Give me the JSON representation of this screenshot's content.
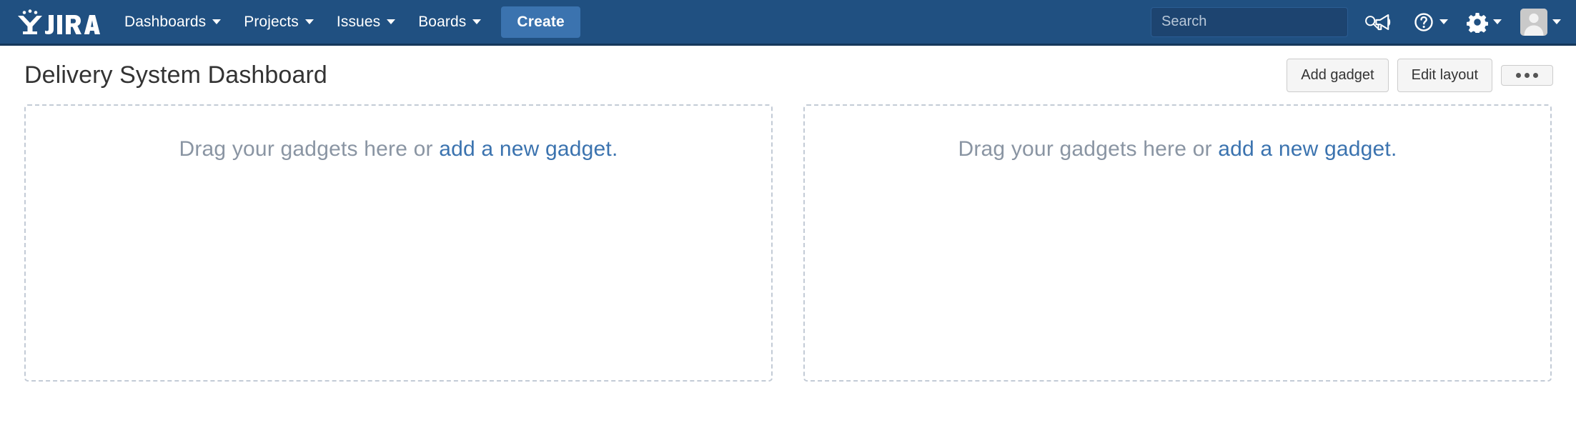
{
  "navbar": {
    "logo_label": "JIRA",
    "items": [
      {
        "label": "Dashboards",
        "has_caret": true
      },
      {
        "label": "Projects",
        "has_caret": true
      },
      {
        "label": "Issues",
        "has_caret": true
      },
      {
        "label": "Boards",
        "has_caret": true
      }
    ],
    "create_label": "Create",
    "search": {
      "placeholder": "Search",
      "value": "",
      "icon": "search-icon"
    },
    "right_icons": [
      {
        "name": "megaphone-icon",
        "has_caret": false
      },
      {
        "name": "help-icon",
        "has_caret": true
      },
      {
        "name": "settings-gear-icon",
        "has_caret": true
      },
      {
        "name": "user-avatar",
        "has_caret": true
      }
    ],
    "colors": {
      "background": "#205081",
      "border_bottom": "#15375b",
      "create_button": "#3b73af",
      "search_background": "#1d4470"
    }
  },
  "page": {
    "title": "Delivery System Dashboard",
    "actions": [
      {
        "label": "Add gadget",
        "name": "add-gadget-button"
      },
      {
        "label": "Edit layout",
        "name": "edit-layout-button"
      }
    ],
    "more_actions_label": "•••"
  },
  "dashboard": {
    "dropzones": [
      {
        "name": "dropzone-left",
        "prompt_text": "Drag your gadgets here or ",
        "link_text": "add a new gadget."
      },
      {
        "name": "dropzone-right",
        "prompt_text": "Drag your gadgets here or ",
        "link_text": "add a new gadget."
      }
    ],
    "colors": {
      "border": "#c3cbd6",
      "text": "#8a95a3",
      "link": "#3b73af"
    }
  }
}
